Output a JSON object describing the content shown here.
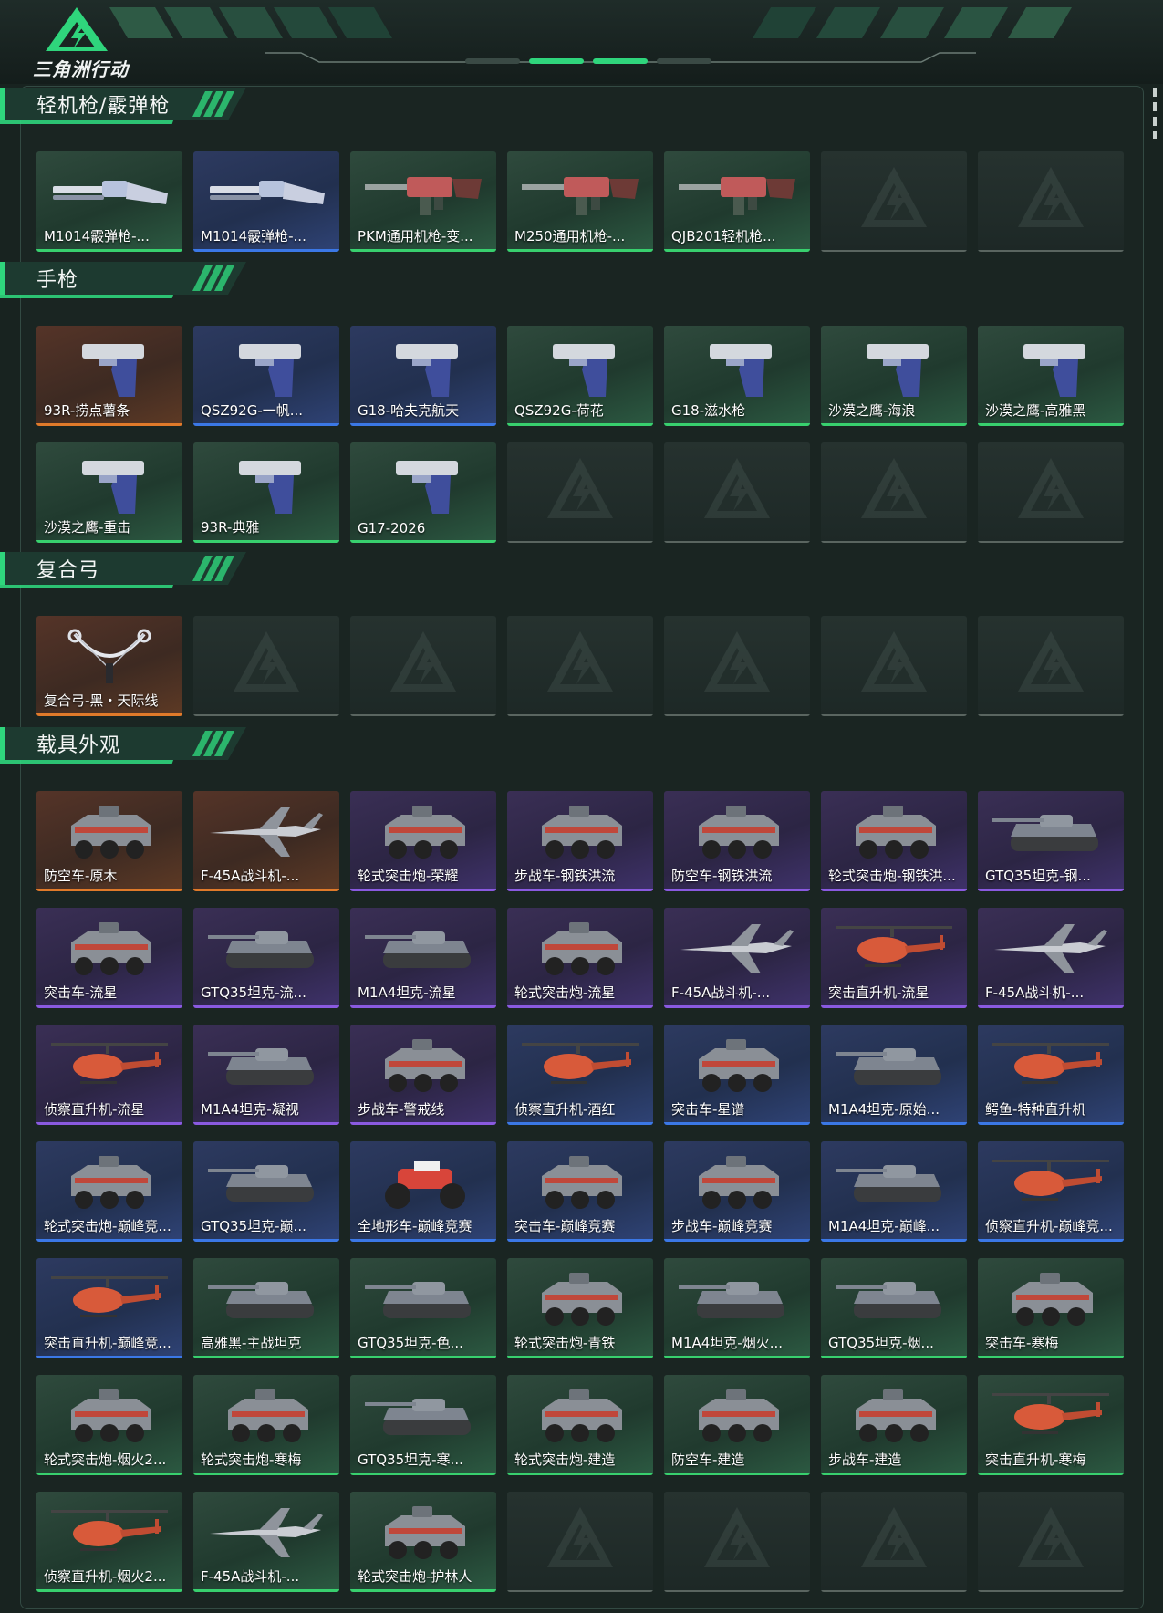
{
  "app": {
    "title": "三角洲行动"
  },
  "colors": {
    "accent": "#38d06e",
    "rarity_green": "#38d06e",
    "rarity_blue": "#3b78e6",
    "rarity_purple": "#8a5ae0",
    "rarity_orange": "#e07a2a"
  },
  "sections": [
    {
      "title": "轻机枪/霰弹枪",
      "items": [
        {
          "label": "M1014霰弹枪-...",
          "rarity": "green",
          "icon": "shotgun-icon"
        },
        {
          "label": "M1014霰弹枪-...",
          "rarity": "blue",
          "icon": "shotgun-icon"
        },
        {
          "label": "PKM通用机枪-变...",
          "rarity": "green",
          "icon": "machine-gun-icon"
        },
        {
          "label": "M250通用机枪-...",
          "rarity": "green",
          "icon": "machine-gun-icon"
        },
        {
          "label": "QJB201轻机枪...",
          "rarity": "green",
          "icon": "machine-gun-icon"
        },
        {
          "label": "",
          "rarity": "empty"
        },
        {
          "label": "",
          "rarity": "empty"
        }
      ]
    },
    {
      "title": "手枪",
      "items": [
        {
          "label": "93R-捞点薯条",
          "rarity": "orange",
          "icon": "pistol-icon"
        },
        {
          "label": "QSZ92G-一帆...",
          "rarity": "blue",
          "icon": "pistol-icon"
        },
        {
          "label": "G18-哈夫克航天",
          "rarity": "blue",
          "icon": "pistol-icon"
        },
        {
          "label": "QSZ92G-荷花",
          "rarity": "green",
          "icon": "pistol-icon"
        },
        {
          "label": "G18-滋水枪",
          "rarity": "green",
          "icon": "pistol-icon"
        },
        {
          "label": "沙漠之鹰-海浪",
          "rarity": "green",
          "icon": "pistol-icon"
        },
        {
          "label": "沙漠之鹰-高雅黑",
          "rarity": "green",
          "icon": "pistol-icon"
        },
        {
          "label": "沙漠之鹰-重击",
          "rarity": "green",
          "icon": "pistol-icon"
        },
        {
          "label": "93R-典雅",
          "rarity": "green",
          "icon": "pistol-icon"
        },
        {
          "label": "G17-2026",
          "rarity": "green",
          "icon": "pistol-icon"
        },
        {
          "label": "",
          "rarity": "empty"
        },
        {
          "label": "",
          "rarity": "empty"
        },
        {
          "label": "",
          "rarity": "empty"
        },
        {
          "label": "",
          "rarity": "empty"
        }
      ]
    },
    {
      "title": "复合弓",
      "items": [
        {
          "label": "复合弓-黑・天际线",
          "rarity": "orange",
          "icon": "bow-icon"
        },
        {
          "label": "",
          "rarity": "empty"
        },
        {
          "label": "",
          "rarity": "empty"
        },
        {
          "label": "",
          "rarity": "empty"
        },
        {
          "label": "",
          "rarity": "empty"
        },
        {
          "label": "",
          "rarity": "empty"
        },
        {
          "label": "",
          "rarity": "empty"
        }
      ]
    },
    {
      "title": "载具外观",
      "items": [
        {
          "label": "防空车-原木",
          "rarity": "orange",
          "icon": "armored-vehicle-icon"
        },
        {
          "label": "F-45A战斗机-...",
          "rarity": "orange",
          "icon": "jet-icon"
        },
        {
          "label": "轮式突击炮-荣耀",
          "rarity": "purple",
          "icon": "armored-vehicle-icon"
        },
        {
          "label": "步战车-钢铁洪流",
          "rarity": "purple",
          "icon": "armored-vehicle-icon"
        },
        {
          "label": "防空车-钢铁洪流",
          "rarity": "purple",
          "icon": "armored-vehicle-icon"
        },
        {
          "label": "轮式突击炮-钢铁洪...",
          "rarity": "purple",
          "icon": "armored-vehicle-icon"
        },
        {
          "label": "GTQ35坦克-钢...",
          "rarity": "purple",
          "icon": "tank-icon"
        },
        {
          "label": "突击车-流星",
          "rarity": "purple",
          "icon": "armored-vehicle-icon"
        },
        {
          "label": "GTQ35坦克-流...",
          "rarity": "purple",
          "icon": "tank-icon"
        },
        {
          "label": "M1A4坦克-流星",
          "rarity": "purple",
          "icon": "tank-icon"
        },
        {
          "label": "轮式突击炮-流星",
          "rarity": "purple",
          "icon": "armored-vehicle-icon"
        },
        {
          "label": "F-45A战斗机-...",
          "rarity": "purple",
          "icon": "jet-icon"
        },
        {
          "label": "突击直升机-流星",
          "rarity": "purple",
          "icon": "helicopter-icon"
        },
        {
          "label": "F-45A战斗机-...",
          "rarity": "purple",
          "icon": "jet-icon"
        },
        {
          "label": "侦察直升机-流星",
          "rarity": "purple",
          "icon": "helicopter-icon"
        },
        {
          "label": "M1A4坦克-凝视",
          "rarity": "purple",
          "icon": "tank-icon"
        },
        {
          "label": "步战车-警戒线",
          "rarity": "purple",
          "icon": "armored-vehicle-icon"
        },
        {
          "label": "侦察直升机-酒红",
          "rarity": "blue",
          "icon": "helicopter-icon"
        },
        {
          "label": "突击车-星谱",
          "rarity": "blue",
          "icon": "armored-vehicle-icon"
        },
        {
          "label": "M1A4坦克-原始...",
          "rarity": "blue",
          "icon": "tank-icon"
        },
        {
          "label": "鳄鱼-特种直升机",
          "rarity": "blue",
          "icon": "helicopter-icon"
        },
        {
          "label": "轮式突击炮-巅峰竞...",
          "rarity": "blue",
          "icon": "armored-vehicle-icon"
        },
        {
          "label": "GTQ35坦克-巅...",
          "rarity": "blue",
          "icon": "tank-icon"
        },
        {
          "label": "全地形车-巅峰竞赛",
          "rarity": "blue",
          "icon": "atv-icon"
        },
        {
          "label": "突击车-巅峰竞赛",
          "rarity": "blue",
          "icon": "armored-vehicle-icon"
        },
        {
          "label": "步战车-巅峰竞赛",
          "rarity": "blue",
          "icon": "armored-vehicle-icon"
        },
        {
          "label": "M1A4坦克-巅峰...",
          "rarity": "blue",
          "icon": "tank-icon"
        },
        {
          "label": "侦察直升机-巅峰竞...",
          "rarity": "blue",
          "icon": "helicopter-icon"
        },
        {
          "label": "突击直升机-巅峰竞...",
          "rarity": "blue",
          "icon": "helicopter-icon"
        },
        {
          "label": "高雅黑-主战坦克",
          "rarity": "green",
          "icon": "tank-icon"
        },
        {
          "label": "GTQ35坦克-色...",
          "rarity": "green",
          "icon": "tank-icon"
        },
        {
          "label": "轮式突击炮-青铁",
          "rarity": "green",
          "icon": "armored-vehicle-icon"
        },
        {
          "label": "M1A4坦克-烟火...",
          "rarity": "green",
          "icon": "tank-icon"
        },
        {
          "label": "GTQ35坦克-烟...",
          "rarity": "green",
          "icon": "tank-icon"
        },
        {
          "label": "突击车-寒梅",
          "rarity": "green",
          "icon": "armored-vehicle-icon"
        },
        {
          "label": "轮式突击炮-烟火2...",
          "rarity": "green",
          "icon": "armored-vehicle-icon"
        },
        {
          "label": "轮式突击炮-寒梅",
          "rarity": "green",
          "icon": "armored-vehicle-icon"
        },
        {
          "label": "GTQ35坦克-寒...",
          "rarity": "green",
          "icon": "tank-icon"
        },
        {
          "label": "轮式突击炮-建造",
          "rarity": "green",
          "icon": "armored-vehicle-icon"
        },
        {
          "label": "防空车-建造",
          "rarity": "green",
          "icon": "armored-vehicle-icon"
        },
        {
          "label": "步战车-建造",
          "rarity": "green",
          "icon": "armored-vehicle-icon"
        },
        {
          "label": "突击直升机-寒梅",
          "rarity": "green",
          "icon": "helicopter-icon"
        },
        {
          "label": "侦察直升机-烟火2...",
          "rarity": "green",
          "icon": "helicopter-icon"
        },
        {
          "label": "F-45A战斗机-...",
          "rarity": "green",
          "icon": "jet-icon"
        },
        {
          "label": "轮式突击炮-护林人",
          "rarity": "green",
          "icon": "armored-vehicle-icon"
        },
        {
          "label": "",
          "rarity": "empty"
        },
        {
          "label": "",
          "rarity": "empty"
        },
        {
          "label": "",
          "rarity": "empty"
        },
        {
          "label": "",
          "rarity": "empty"
        }
      ]
    }
  ]
}
